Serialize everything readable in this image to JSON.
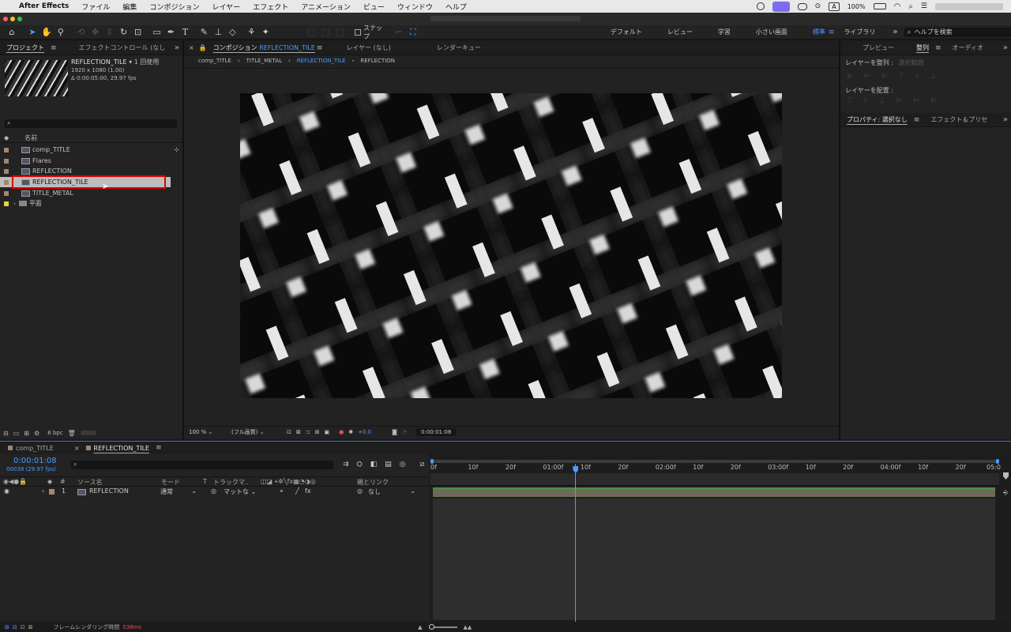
{
  "menubar": {
    "app_name": "After Effects",
    "items": [
      "ファイル",
      "編集",
      "コンポジション",
      "レイヤー",
      "エフェクト",
      "アニメーション",
      "ビュー",
      "ウィンドウ",
      "ヘルプ"
    ],
    "battery": "100%"
  },
  "toolbar": {
    "snap_label": "スナップ",
    "workspaces": [
      "デフォルト",
      "レビュー",
      "学習",
      "小さい画面",
      "標準",
      "ライブラリ"
    ],
    "active_workspace": "標準",
    "search_placeholder": "ヘルプを検索"
  },
  "project": {
    "tabs": [
      "プロジェクト",
      "エフェクトコントロール (なし"
    ],
    "preview": {
      "name": "REFLECTION_TILE",
      "usage": "▾ 1 回使用",
      "size": "1920 x 1080 (1.00)",
      "duration": "Δ 0:00:05:00, 29.97 fps"
    },
    "search_placeholder": "",
    "column_name": "名前",
    "items": [
      {
        "name": "comp_TITLE",
        "type": "comp",
        "color": "#a08870"
      },
      {
        "name": "Flares",
        "type": "comp",
        "color": "#a08870"
      },
      {
        "name": "REFLECTION",
        "type": "comp",
        "color": "#a08870"
      },
      {
        "name": "REFLECTION_TILE",
        "type": "comp",
        "color": "#a08870",
        "selected": true
      },
      {
        "name": "TITLE_METAL",
        "type": "comp",
        "color": "#a08870"
      },
      {
        "name": "平面",
        "type": "folder",
        "color": "#e8d23a"
      }
    ],
    "bpc": "8 bpc"
  },
  "composition": {
    "tab_label": "コンポジション",
    "tab_comp": "REFLECTION_TILE",
    "layer_tab": "レイヤー (なし)",
    "render_tab": "レンダーキュー",
    "breadcrumbs": [
      "comp_TITLE",
      "TITLE_METAL",
      "REFLECTION_TILE",
      "REFLECTION"
    ],
    "active_breadcrumb": "REFLECTION_TILE",
    "zoom": "100 %",
    "quality": "(フル画質)",
    "exposure": "+0.0",
    "timecode": "0:00:01:08"
  },
  "right": {
    "tabs": [
      "プレビュー",
      "整列",
      "オーディオ"
    ],
    "align_to": "レイヤーを整列 :",
    "align_to_value": "選択範囲",
    "distribute": "レイヤーを配置 :",
    "tabs2": [
      "プロパティ: 選択なし",
      "エフェクト＆プリセ"
    ]
  },
  "timeline": {
    "tabs": [
      "comp_TITLE",
      "REFLECTION_TILE"
    ],
    "current_time": "0:00:01:08",
    "frame_info": "00038 (29.97 fps)",
    "columns": {
      "source": "ソース名",
      "mode": "モード",
      "t": "T",
      "track": "トラックマ..",
      "parent": "親とリンク"
    },
    "layers": [
      {
        "index": "1",
        "name": "REFLECTION",
        "mode": "通常",
        "track": "マットな",
        "parent": "なし"
      }
    ],
    "ruler": [
      "0f",
      "10f",
      "20f",
      "01:00f",
      "10f",
      "20f",
      "02:00f",
      "10f",
      "20f",
      "03:00f",
      "10f",
      "20f",
      "04:00f",
      "10f",
      "20f",
      "05:0"
    ],
    "playhead_frame": 38,
    "total_frames": 150,
    "status": "フレームレンダリング時間",
    "status_value": "538ms"
  },
  "colors": {
    "accent": "#4b9cff",
    "selection_box": "#e00000",
    "layer_bar": "#6f6a58",
    "work_area": "#3c8cff"
  }
}
